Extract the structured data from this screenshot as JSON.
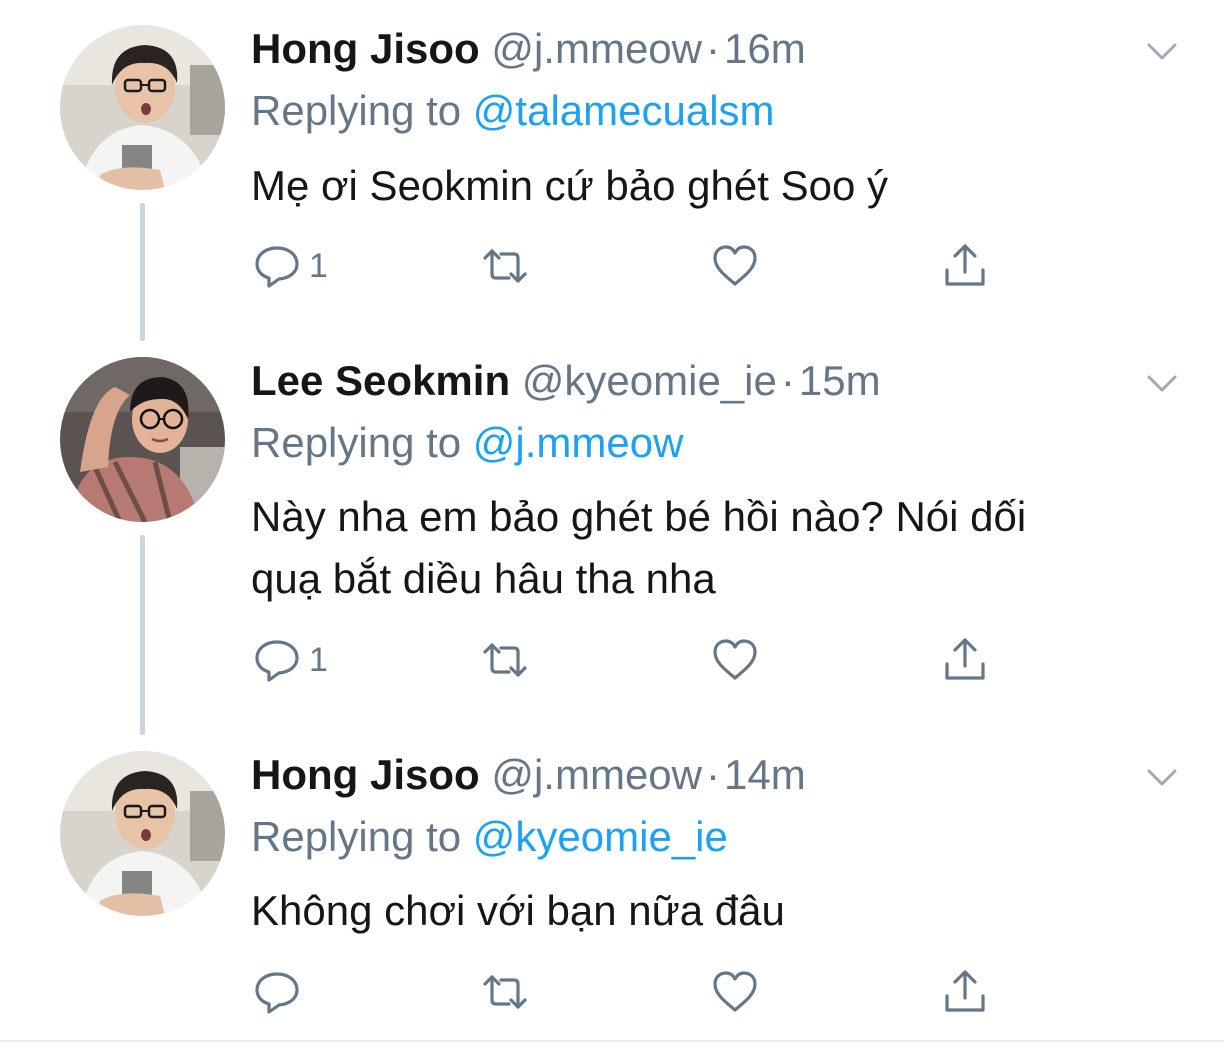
{
  "thread": {
    "tweets": [
      {
        "author_name": "Hong Jisoo",
        "author_handle": "@j.mmeow",
        "separator": "·",
        "time": "16m",
        "replying_prefix": "Replying to",
        "replying_to": "@talamecualsm",
        "text": "Mẹ ơi Seokmin cứ bảo ghét Soo ý",
        "reply_count": "1",
        "retweet_count": "",
        "like_count": ""
      },
      {
        "author_name": "Lee Seokmin",
        "author_handle": "@kyeomie_ie",
        "separator": "·",
        "time": "15m",
        "replying_prefix": "Replying to",
        "replying_to": "@j.mmeow",
        "text_line1": "Này nha em bảo ghét bé hồi nào? Nói dối",
        "text_line2": "quạ bắt diều hâu tha nha",
        "reply_count": "1",
        "retweet_count": "",
        "like_count": ""
      },
      {
        "author_name": "Hong Jisoo",
        "author_handle": "@j.mmeow",
        "separator": "·",
        "time": "14m",
        "replying_prefix": "Replying to",
        "replying_to": "@kyeomie_ie",
        "text": "Không chơi với bạn nữa đâu",
        "reply_count": "",
        "retweet_count": "",
        "like_count": ""
      }
    ]
  },
  "icons": {
    "reply": "reply-icon",
    "retweet": "retweet-icon",
    "like": "heart-icon",
    "share": "share-icon",
    "menu": "chevron-down-icon"
  },
  "colors": {
    "name": "#14171a",
    "secondary": "#657786",
    "link": "#1da1f2",
    "thread_line": "#ccd6dd",
    "icon": "#657786"
  }
}
